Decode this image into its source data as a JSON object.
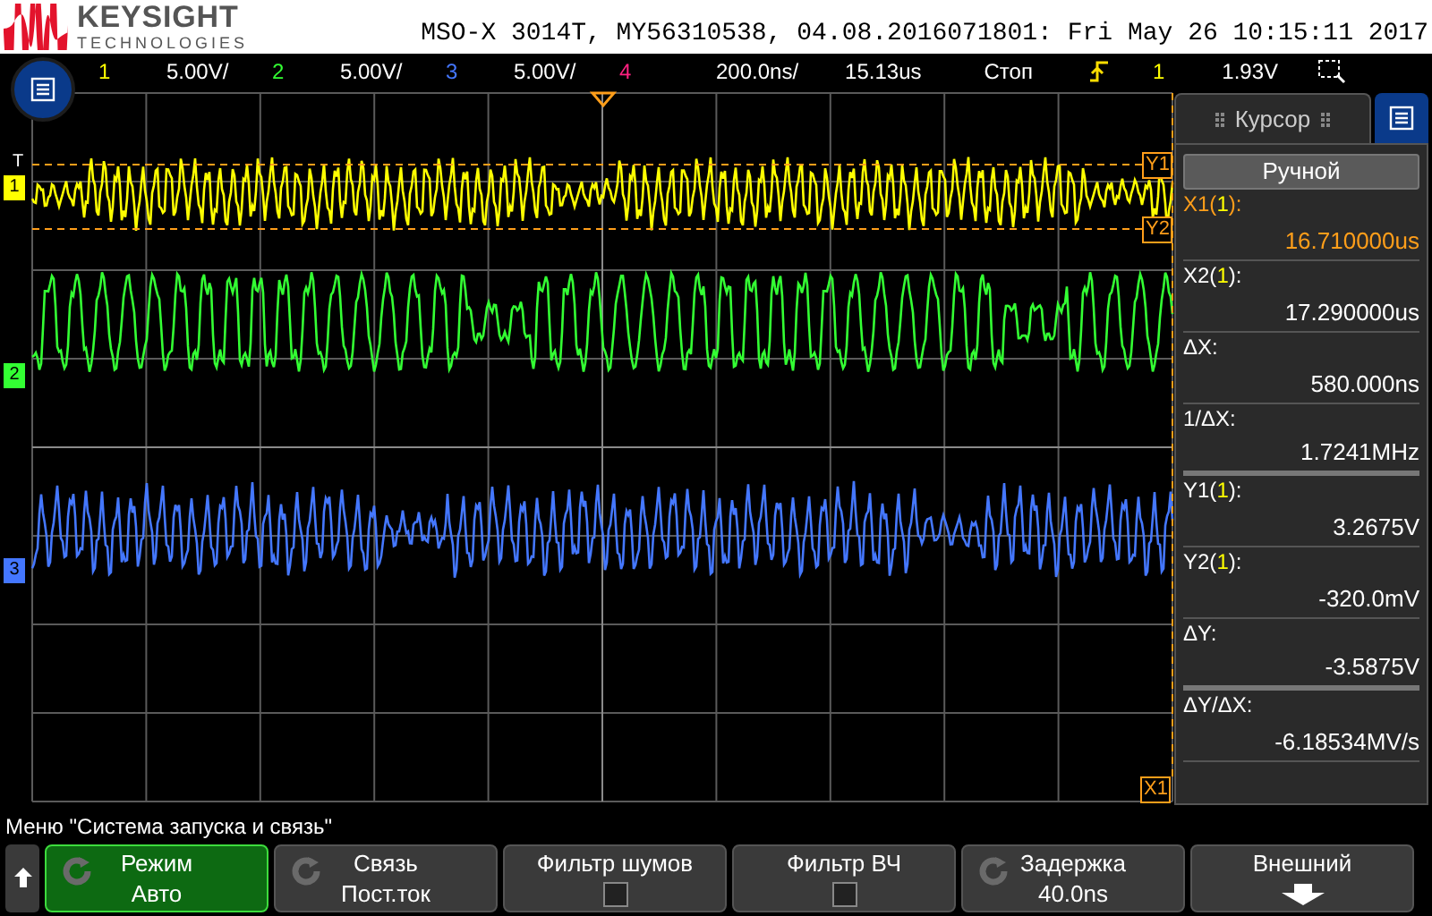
{
  "header": {
    "brand": "KEYSIGHT",
    "brand_sub": "TECHNOLOGIES",
    "title": "MSO-X 3014T, MY56310538, 04.08.2016071801: Fri May 26 10:15:11 2017"
  },
  "status_bar": {
    "channels": [
      {
        "number": "1",
        "scale": "5.00V/",
        "color": "#ffff00"
      },
      {
        "number": "2",
        "scale": "5.00V/",
        "color": "#33ff33"
      },
      {
        "number": "3",
        "scale": "5.00V/",
        "color": "#4477ff"
      },
      {
        "number": "4",
        "color": "#ff2080"
      }
    ],
    "timebase": "200.0ns/",
    "delay": "15.13us",
    "run_state": "Стоп",
    "trigger_source": "1",
    "trigger_level": "1.93V"
  },
  "display": {
    "trigger_marker": "T",
    "channel_markers": [
      {
        "label": "1",
        "color": "#ffff00"
      },
      {
        "label": "2",
        "color": "#33ff33"
      },
      {
        "label": "3",
        "color": "#4477ff"
      }
    ],
    "cursor_labels": [
      "Y1",
      "Y2",
      "X1"
    ]
  },
  "cursor_panel": {
    "tab": "Курсор",
    "mode": "Ручной",
    "rows": [
      {
        "prefix": "X1(",
        "channel": "1",
        "suffix": "):",
        "value": "16.710000us",
        "color": "#ff9e1a",
        "thick_divider": false
      },
      {
        "prefix": "X2(",
        "channel": "1",
        "suffix": "):",
        "value": "17.290000us",
        "color": "#ffffff",
        "thick_divider": false
      },
      {
        "prefix": "ΔX:",
        "value": "580.000ns",
        "color": "#ffffff",
        "thick_divider": false
      },
      {
        "prefix": "1/ΔX:",
        "value": "1.7241MHz",
        "color": "#ffffff",
        "thick_divider": true
      },
      {
        "prefix": "Y1(",
        "channel": "1",
        "suffix": "):",
        "value": "3.2675V",
        "color": "#ffffff",
        "thick_divider": false
      },
      {
        "prefix": "Y2(",
        "channel": "1",
        "suffix": "):",
        "value": "-320.0mV",
        "color": "#ffffff",
        "thick_divider": false
      },
      {
        "prefix": "ΔY:",
        "value": "-3.5875V",
        "color": "#ffffff",
        "thick_divider": true
      },
      {
        "prefix": "ΔY/ΔX:",
        "value": "-6.18534MV/s",
        "color": "#ffffff",
        "thick_divider": false
      }
    ]
  },
  "menu_title": "Меню \"Система запуска и связь\"",
  "softkeys": [
    {
      "kind": "value",
      "label": "Режим",
      "value": "Авто",
      "knob": true,
      "selected": true
    },
    {
      "kind": "value",
      "label": "Связь",
      "value": "Пост.ток",
      "knob": true,
      "selected": false
    },
    {
      "kind": "checkbox",
      "label": "Фильтр шумов",
      "checked": false,
      "knob": false,
      "selected": false
    },
    {
      "kind": "checkbox",
      "label": "Фильтр ВЧ",
      "checked": false,
      "knob": false,
      "selected": false
    },
    {
      "kind": "value",
      "label": "Задержка",
      "value": "40.0ns",
      "knob": true,
      "selected": false
    },
    {
      "kind": "submenu",
      "label": "Внешний",
      "knob": false,
      "selected": false
    }
  ]
}
